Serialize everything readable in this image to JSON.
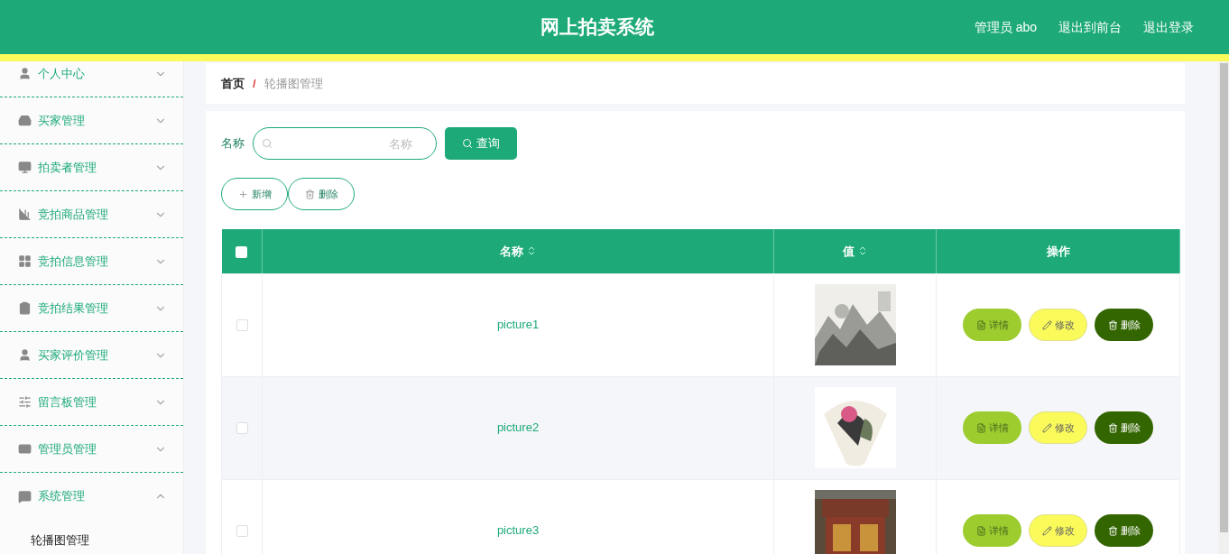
{
  "header": {
    "title": "网上拍卖系统",
    "user_label": "管理员 abo",
    "links": [
      "退出到前台",
      "退出登录"
    ]
  },
  "sidebar": {
    "items": [
      {
        "label": "个人中心",
        "expanded": false
      },
      {
        "label": "买家管理",
        "expanded": false
      },
      {
        "label": "拍卖者管理",
        "expanded": false
      },
      {
        "label": "竞拍商品管理",
        "expanded": false
      },
      {
        "label": "竞拍信息管理",
        "expanded": false
      },
      {
        "label": "竞拍结果管理",
        "expanded": false
      },
      {
        "label": "买家评价管理",
        "expanded": false
      },
      {
        "label": "留言板管理",
        "expanded": false
      },
      {
        "label": "管理员管理",
        "expanded": false
      },
      {
        "label": "系统管理",
        "expanded": true,
        "children": [
          {
            "label": "轮播图管理"
          }
        ]
      }
    ]
  },
  "breadcrumb": {
    "items": [
      "首页",
      "轮播图管理"
    ],
    "separator": "/"
  },
  "search": {
    "label": "名称",
    "placeholder": "名称",
    "button": "查询"
  },
  "actions": [
    {
      "kind": "add",
      "label": "新增"
    },
    {
      "kind": "delete",
      "label": "删除"
    }
  ],
  "table": {
    "select_all_checked": false,
    "columns": [
      {
        "label": "名称",
        "sortable": true
      },
      {
        "label": "值",
        "sortable": true
      },
      {
        "label": "操作",
        "sortable": false
      }
    ],
    "rows": [
      {
        "selected": false,
        "name": "picture1",
        "actions": [
          {
            "kind": "detail",
            "label": "详情"
          },
          {
            "kind": "edit",
            "label": "修改"
          },
          {
            "kind": "delete",
            "label": "删除"
          }
        ]
      },
      {
        "selected": false,
        "name": "picture2",
        "actions": [
          {
            "kind": "detail",
            "label": "详情"
          },
          {
            "kind": "edit",
            "label": "修改"
          },
          {
            "kind": "delete",
            "label": "删除"
          }
        ]
      },
      {
        "selected": false,
        "name": "picture3",
        "actions": [
          {
            "kind": "detail",
            "label": "详情"
          },
          {
            "kind": "edit",
            "label": "修改"
          },
          {
            "kind": "delete",
            "label": "删除"
          }
        ]
      }
    ]
  }
}
